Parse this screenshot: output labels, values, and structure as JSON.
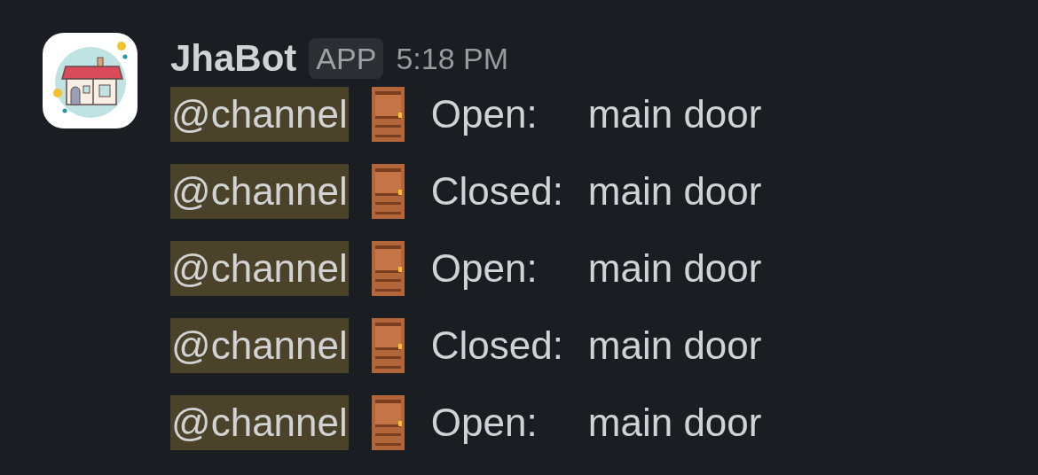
{
  "message": {
    "sender": "JhaBot",
    "badge": "APP",
    "time": "5:18 PM",
    "lines": [
      {
        "mention": "@channel",
        "status": "Open:",
        "target": "main door"
      },
      {
        "mention": "@channel",
        "status": "Closed:",
        "target": "main door"
      },
      {
        "mention": "@channel",
        "status": "Open:",
        "target": "main door"
      },
      {
        "mention": "@channel",
        "status": "Closed:",
        "target": "main door"
      },
      {
        "mention": "@channel",
        "status": "Open:",
        "target": "main door"
      }
    ]
  }
}
